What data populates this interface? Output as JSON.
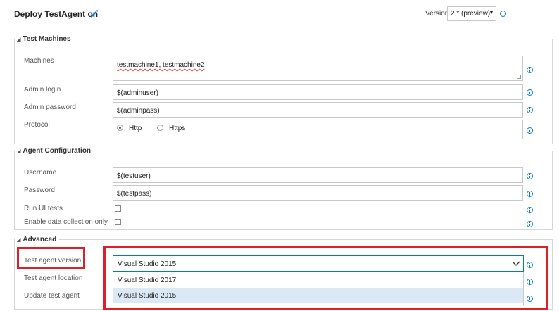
{
  "header": {
    "title": "Deploy TestAgent on",
    "version_label": "Version",
    "version_value": "2.* (preview)"
  },
  "sections": {
    "test_machines": {
      "title": "Test Machines",
      "machines_label": "Machines",
      "machines_value": "testmachine1, testmachine2",
      "admin_login_label": "Admin login",
      "admin_login_value": "$(adminuser)",
      "admin_password_label": "Admin password",
      "admin_password_value": "$(adminpass)",
      "protocol_label": "Protocol",
      "protocol_options": [
        "Http",
        "Https"
      ],
      "protocol_selected": "Http"
    },
    "agent_configuration": {
      "title": "Agent Configuration",
      "username_label": "Username",
      "username_value": "$(testuser)",
      "password_label": "Password",
      "password_value": "$(testpass)",
      "run_ui_tests_label": "Run UI tests",
      "run_ui_tests_checked": false,
      "data_collection_label": "Enable data collection only",
      "data_collection_checked": false
    },
    "advanced": {
      "title": "Advanced",
      "test_agent_version_label": "Test agent version",
      "test_agent_version_value": "Visual Studio 2015",
      "test_agent_version_options": [
        "Visual Studio 2017",
        "Visual Studio 2015"
      ],
      "test_agent_location_label": "Test agent location",
      "update_test_agent_label": "Update test agent"
    }
  },
  "colors": {
    "accent": "#0078d7",
    "highlight_red": "#e01e28",
    "selected_option_bg": "#dbe8f5"
  },
  "icons": {
    "edit": "pencil-icon",
    "info": "info-icon",
    "dropdown": "chevron-down-icon"
  }
}
